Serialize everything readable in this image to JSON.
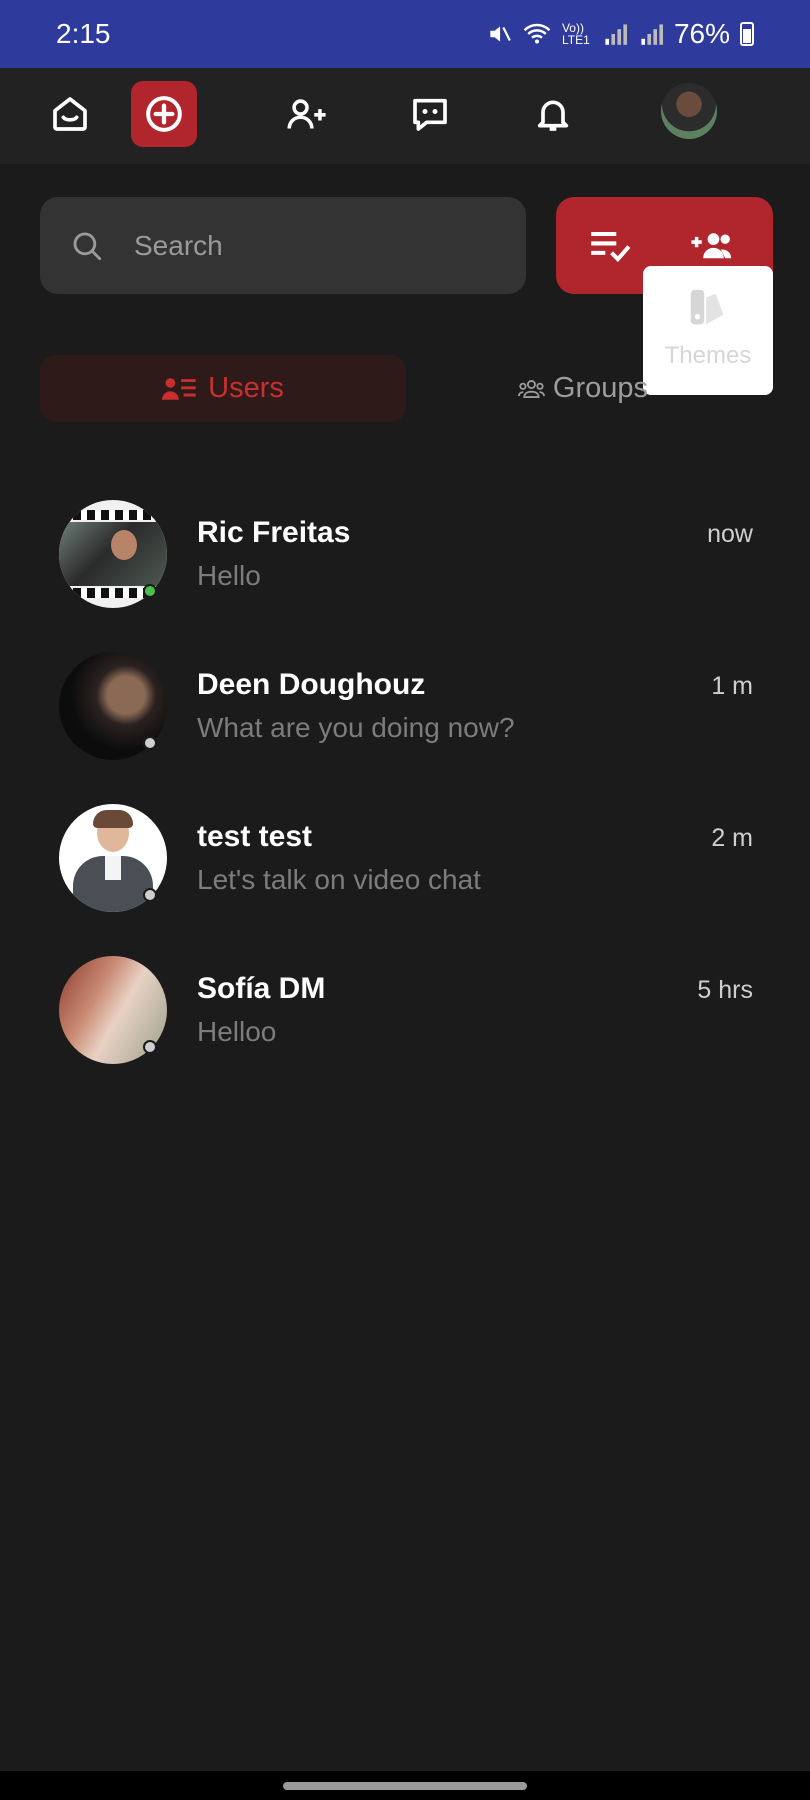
{
  "status_bar": {
    "time": "2:15",
    "battery": "76%",
    "network": "Vo)) LTE1"
  },
  "nav": {
    "icons": [
      "home-icon",
      "add-circle-icon",
      "add-user-icon",
      "chat-icon",
      "bell-icon",
      "profile-avatar"
    ],
    "accent": "#b0262c"
  },
  "search": {
    "placeholder": "Search"
  },
  "actions": {
    "icons": [
      "checklist-icon",
      "group-add-icon"
    ]
  },
  "themes_popup": {
    "label": "Themes"
  },
  "tabs": {
    "users": "Users",
    "groups": "Groups"
  },
  "chats": [
    {
      "name": "Ric Freitas",
      "message": "Hello",
      "time": "now",
      "online": true
    },
    {
      "name": "Deen Doughouz",
      "message": "What are you doing now?",
      "time": "1 m",
      "online": false
    },
    {
      "name": "test test",
      "message": "Let's talk on video chat",
      "time": "2 m",
      "online": false
    },
    {
      "name": "Sofía DM",
      "message": "Helloo",
      "time": "5 hrs",
      "online": false
    }
  ],
  "colors": {
    "online": "#4cbf53",
    "offline": "#cfcfcf",
    "background": "#1b1b1b",
    "status_bar": "#2e3a9c"
  }
}
